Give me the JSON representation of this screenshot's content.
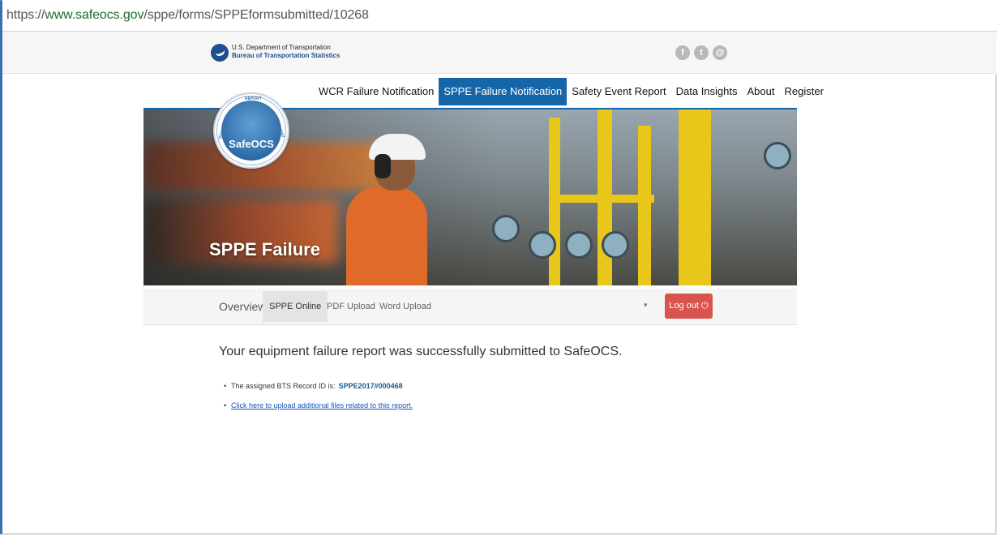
{
  "browser": {
    "url_scheme": "https://",
    "url_host": "www.safeocs.gov",
    "url_path": "/sppe/forms/SPPEformsubmitted/10268"
  },
  "agency": {
    "line1": "U.S. Department of Transportation",
    "line2": "Bureau of Transportation Statistics",
    "social_icons": [
      "facebook-icon",
      "twitter-icon",
      "email-icon"
    ]
  },
  "nav": {
    "items": [
      {
        "label": "WCR Failure Notification"
      },
      {
        "label": "SPPE Failure Notification",
        "active": true
      },
      {
        "label": "Safety Event Report"
      },
      {
        "label": "Data Insights"
      },
      {
        "label": "About"
      },
      {
        "label": "Register"
      }
    ]
  },
  "seal": {
    "label": "SafeOCS",
    "ring_top": "REPORT",
    "ring_left": "DISCOVER",
    "ring_right": "PREVENT"
  },
  "hero": {
    "title": "SPPE Failure"
  },
  "subnav": {
    "tabs": [
      {
        "label": "Overview"
      },
      {
        "label": "SPPE Online",
        "active": true
      },
      {
        "label": "PDF Upload"
      },
      {
        "label": "Word Upload"
      }
    ],
    "dropdown_caret": "▾",
    "logout_label": "Log out",
    "logout_icon": "power-icon"
  },
  "content": {
    "message": "Your equipment failure report was successfully submitted to SafeOCS.",
    "record_prefix": "The assigned BTS Record ID is:",
    "record_id": "SPPE2017#000468",
    "upload_link": "Click here to upload additional files related to this report."
  },
  "colors": {
    "nav_active": "#1466a8",
    "logout_button": "#d9534f",
    "link": "#1a55b0"
  }
}
